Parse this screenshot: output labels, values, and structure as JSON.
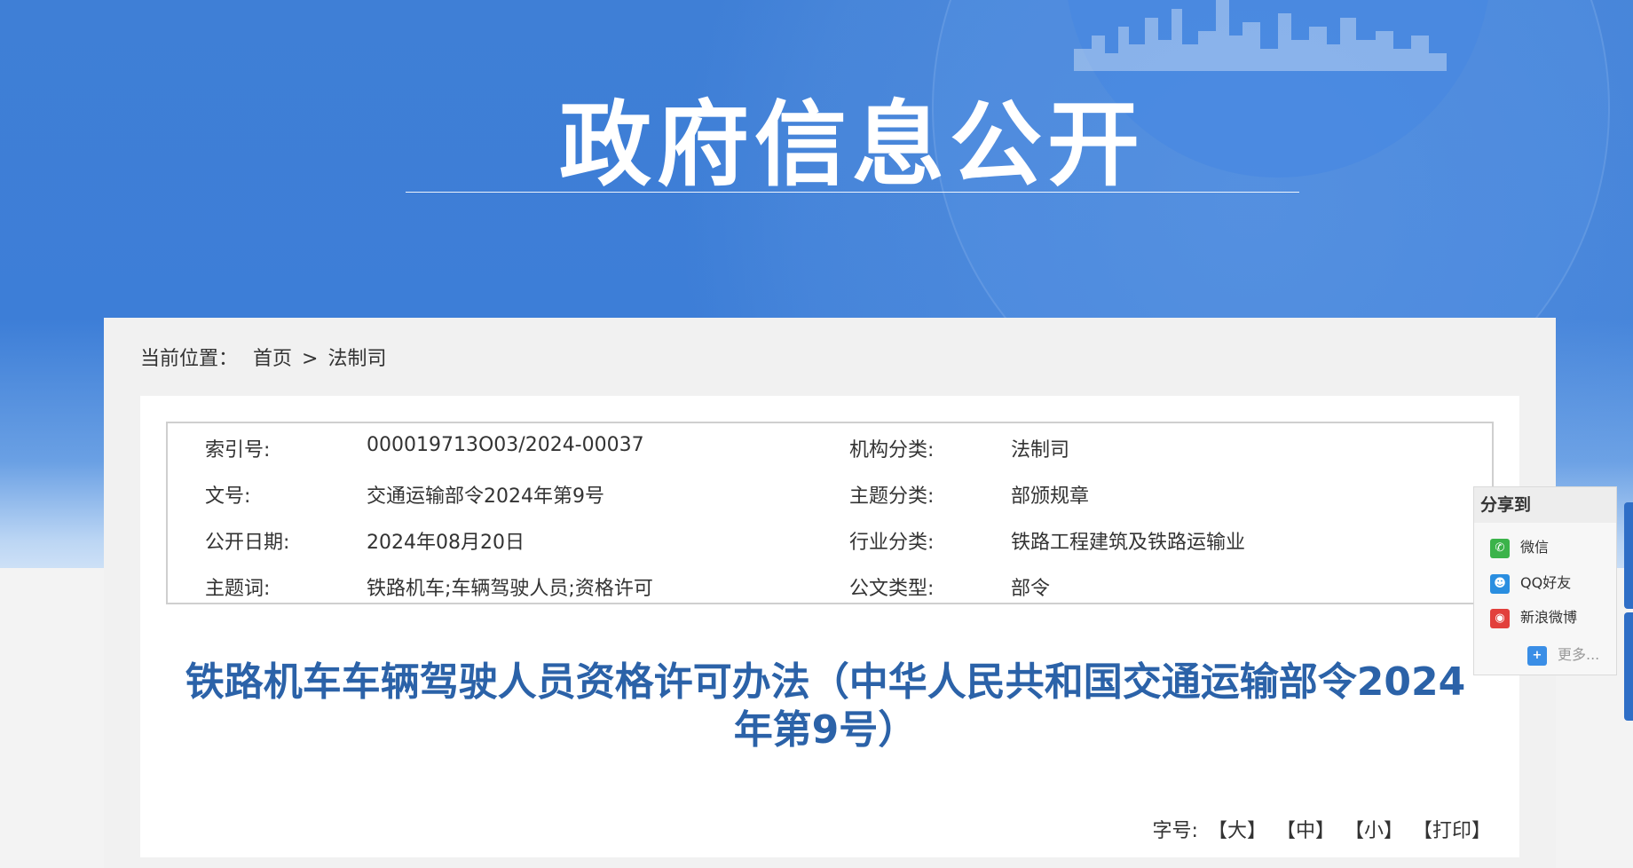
{
  "banner": {
    "title": "政府信息公开"
  },
  "breadcrumb": {
    "prefix": "当前位置：",
    "home": "首页",
    "sep": ">",
    "section": "法制司"
  },
  "meta": {
    "index_label": "索引号:",
    "index_value": "000019713O03/2024-00037",
    "org_label": "机构分类:",
    "org_value": "法制司",
    "docno_label": "文号:",
    "docno_value": "交通运输部令2024年第9号",
    "topic_label": "主题分类:",
    "topic_value": "部颁规章",
    "date_label": "公开日期:",
    "date_value": "2024年08月20日",
    "industry_label": "行业分类:",
    "industry_value": "铁路工程建筑及铁路运输业",
    "keywords_label": "主题词:",
    "keywords_value": "铁路机车;车辆驾驶人员;资格许可",
    "type_label": "公文类型:",
    "type_value": "部令"
  },
  "document": {
    "title_line1": "铁路机车车辆驾驶人员资格许可办法（中华人民共和国交通运输部令2024",
    "title_line2": "年第9号）"
  },
  "font_size": {
    "label": "字号:",
    "large": "【大】",
    "medium": "【中】",
    "small": "【小】",
    "print": "【打印】"
  },
  "share": {
    "header": "分享到",
    "items": [
      {
        "label": "微信",
        "icon": "wechat-icon"
      },
      {
        "label": "QQ好友",
        "icon": "qq-icon"
      },
      {
        "label": "新浪微博",
        "icon": "weibo-icon"
      }
    ],
    "more": "更多..."
  },
  "colors": {
    "banner": "#3d7ed7",
    "title": "#2b62a8",
    "accent": "#2f6ec6"
  }
}
